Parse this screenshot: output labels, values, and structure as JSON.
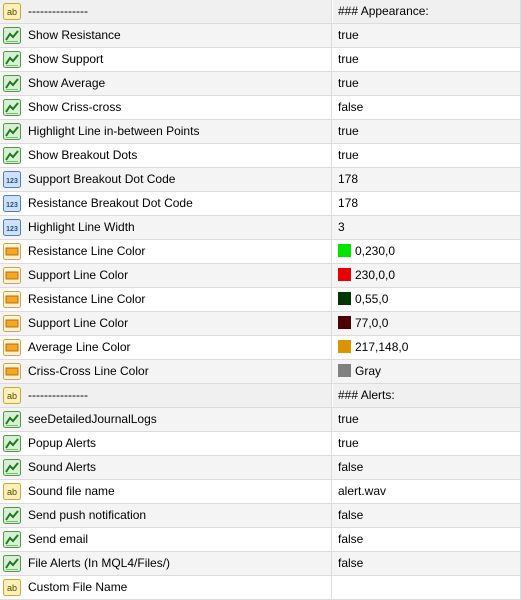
{
  "rows": [
    {
      "icon": "text-ab-icon",
      "name": "---------------",
      "value": "### Appearance:",
      "sep": true
    },
    {
      "icon": "bool-icon",
      "name": "Show Resistance",
      "value": "true"
    },
    {
      "icon": "bool-icon",
      "name": "Show Support",
      "value": "true"
    },
    {
      "icon": "bool-icon",
      "name": "Show Average",
      "value": "true"
    },
    {
      "icon": "bool-icon",
      "name": "Show Criss-cross",
      "value": "false"
    },
    {
      "icon": "bool-icon",
      "name": "Highlight Line in-between Points",
      "value": "true"
    },
    {
      "icon": "bool-icon",
      "name": "Show Breakout Dots",
      "value": "true"
    },
    {
      "icon": "number-123-icon",
      "name": "Support Breakout Dot Code",
      "value": "178"
    },
    {
      "icon": "number-123-icon",
      "name": "Resistance Breakout Dot Code",
      "value": "178"
    },
    {
      "icon": "number-123-icon",
      "name": "Highlight Line Width",
      "value": "3"
    },
    {
      "icon": "color-icon",
      "name": "Resistance Line Color",
      "value": "0,230,0",
      "swatch": "#00e600"
    },
    {
      "icon": "color-icon",
      "name": "Support Line Color",
      "value": "230,0,0",
      "swatch": "#e60000"
    },
    {
      "icon": "color-icon",
      "name": "Resistance Line Color",
      "value": "0,55,0",
      "swatch": "#003700"
    },
    {
      "icon": "color-icon",
      "name": "Support Line Color",
      "value": "77,0,0",
      "swatch": "#4d0000"
    },
    {
      "icon": "color-icon",
      "name": "Average Line Color",
      "value": "217,148,0",
      "swatch": "#d99400"
    },
    {
      "icon": "color-icon",
      "name": "Criss-Cross Line Color",
      "value": "Gray",
      "swatch": "#808080"
    },
    {
      "icon": "text-ab-icon",
      "name": "---------------",
      "value": "### Alerts:",
      "sep": true
    },
    {
      "icon": "bool-icon",
      "name": "seeDetailedJournalLogs",
      "value": "true"
    },
    {
      "icon": "bool-icon",
      "name": "Popup Alerts",
      "value": "true"
    },
    {
      "icon": "bool-icon",
      "name": "Sound Alerts",
      "value": "false"
    },
    {
      "icon": "text-ab-icon",
      "name": "Sound file name",
      "value": "alert.wav"
    },
    {
      "icon": "bool-icon",
      "name": "Send push notification",
      "value": "false"
    },
    {
      "icon": "bool-icon",
      "name": "Send email",
      "value": "false"
    },
    {
      "icon": "bool-icon",
      "name": "File Alerts (In MQL4/Files/)",
      "value": "false"
    },
    {
      "icon": "text-ab-icon",
      "name": "Custom File Name",
      "value": ""
    }
  ]
}
